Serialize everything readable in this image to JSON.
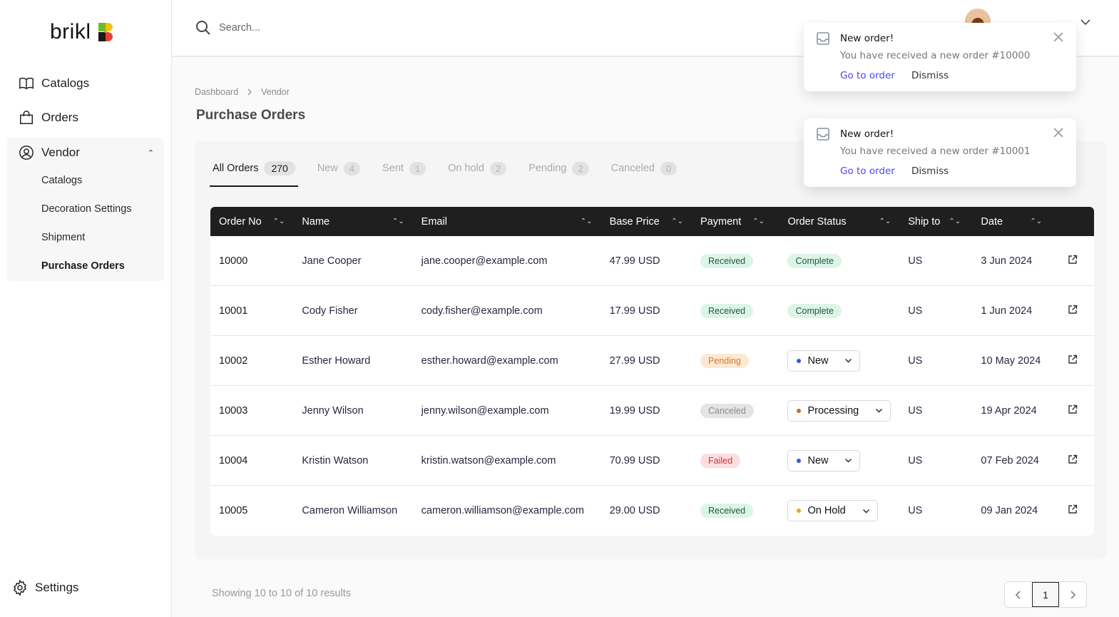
{
  "app": {
    "logo_text": "brikl"
  },
  "sidebar": {
    "items": [
      {
        "label": "Catalogs",
        "icon": "book-icon"
      },
      {
        "label": "Orders",
        "icon": "shopping-bag-icon"
      }
    ],
    "vendor": {
      "label": "Vendor",
      "icon": "user-circle-icon",
      "expanded": true,
      "sub_items": [
        {
          "label": "Catalogs",
          "active": false
        },
        {
          "label": "Decoration Settings",
          "active": false
        },
        {
          "label": "Shipment",
          "active": false
        },
        {
          "label": "Purchase Orders",
          "active": true
        }
      ]
    },
    "settings_label": "Settings"
  },
  "topbar": {
    "search_placeholder": "Search..."
  },
  "breadcrumb": [
    "Dashboard",
    "Vendor"
  ],
  "page_title": "Purchase Orders",
  "tabs": [
    {
      "label": "All Orders",
      "count": "270",
      "active": true
    },
    {
      "label": "New",
      "count": "4",
      "active": false
    },
    {
      "label": "Sent",
      "count": "1",
      "active": false
    },
    {
      "label": "On hold",
      "count": "2",
      "active": false
    },
    {
      "label": "Pending",
      "count": "2",
      "active": false
    },
    {
      "label": "Canceled",
      "count": "0",
      "active": false
    }
  ],
  "table": {
    "columns": [
      "Order No",
      "Name",
      "Email",
      "Base Price",
      "Payment",
      "Order Status",
      "Ship to",
      "Date"
    ],
    "rows": [
      {
        "order_no": "10000",
        "name": "Jane Cooper",
        "email": "jane.cooper@example.com",
        "price": "47.99 USD",
        "payment": "Received",
        "payment_kind": "received",
        "status": "Complete",
        "status_type": "pill",
        "ship_to": "US",
        "date": "3 Jun 2024"
      },
      {
        "order_no": "10001",
        "name": "Cody Fisher",
        "email": "cody.fisher@example.com",
        "price": "17.99 USD",
        "payment": "Received",
        "payment_kind": "received",
        "status": "Complete",
        "status_type": "pill",
        "ship_to": "US",
        "date": "1 Jun 2024"
      },
      {
        "order_no": "10002",
        "name": "Esther Howard",
        "email": "esther.howard@example.com",
        "price": "27.99 USD",
        "payment": "Pending",
        "payment_kind": "pending",
        "status": "New",
        "status_type": "select",
        "status_dot": "#2f5bd8",
        "ship_to": "US",
        "date": "10 May 2024"
      },
      {
        "order_no": "10003",
        "name": "Jenny Wilson",
        "email": "jenny.wilson@example.com",
        "price": "19.99 USD",
        "payment": "Canceled",
        "payment_kind": "canceled",
        "status": "Processing",
        "status_type": "select",
        "status_dot": "#d2691e",
        "ship_to": "US",
        "date": "19 Apr 2024"
      },
      {
        "order_no": "10004",
        "name": "Kristin Watson",
        "email": "kristin.watson@example.com",
        "price": "70.99 USD",
        "payment": "Failed",
        "payment_kind": "failed",
        "status": "New",
        "status_type": "select",
        "status_dot": "#2f5bd8",
        "ship_to": "US",
        "date": "07 Feb 2024"
      },
      {
        "order_no": "10005",
        "name": "Cameron Williamson",
        "email": "cameron.williamson@example.com",
        "price": "29.00 USD",
        "payment": "Received",
        "payment_kind": "received",
        "status": "On Hold",
        "status_type": "select",
        "status_dot": "#e6a817",
        "ship_to": "US",
        "date": "09 Jan 2024"
      }
    ]
  },
  "footer": {
    "showing_text": "Showing 10 to 10 of 10 results",
    "current_page": "1"
  },
  "toasts": [
    {
      "title": "New order!",
      "message": "You have received a new order #10000",
      "action_label": "Go to order",
      "dismiss_label": "Dismiss"
    },
    {
      "title": "New order!",
      "message": "You have received a new order #10001",
      "action_label": "Go to order",
      "dismiss_label": "Dismiss"
    }
  ]
}
